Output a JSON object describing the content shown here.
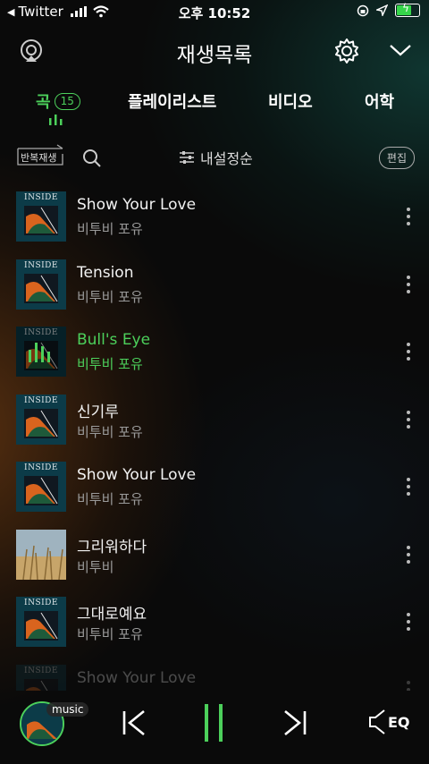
{
  "status_bar": {
    "back_app": "Twitter",
    "time": "오후 10:52"
  },
  "header": {
    "title": "재생목록"
  },
  "tabs": [
    {
      "label": "곡",
      "badge": "15",
      "active": true
    },
    {
      "label": "플레이리스트"
    },
    {
      "label": "비디오"
    },
    {
      "label": "어학"
    }
  ],
  "toolbar": {
    "repeat_label": "반복재생",
    "sort_label": "내설정순",
    "edit_label": "편집"
  },
  "songs": [
    {
      "title": "Show Your Love",
      "artist": "비투비 포유",
      "cover": "inside"
    },
    {
      "title": "Tension",
      "artist": "비투비 포유",
      "cover": "inside"
    },
    {
      "title": "Bull's Eye",
      "artist": "비투비 포유",
      "cover": "inside",
      "playing": true
    },
    {
      "title": "신기루",
      "artist": "비투비 포유",
      "cover": "inside"
    },
    {
      "title": "Show Your Love",
      "artist": "비투비 포유",
      "cover": "inside"
    },
    {
      "title": "그리워하다",
      "artist": "비투비",
      "cover": "field"
    },
    {
      "title": "그대로예요",
      "artist": "비투비 포유",
      "cover": "inside"
    },
    {
      "title": "Show Your Love",
      "artist": "비투비 포유",
      "cover": "inside",
      "faded": true
    }
  ],
  "cover_text": "INSIDE",
  "player": {
    "source_label": "music",
    "eq_label": "EQ"
  },
  "colors": {
    "accent": "#4cd05b",
    "cover_teal": "#0c3b48",
    "cover_orange": "#d9641e",
    "cover_green": "#1e5a3a"
  },
  "icons": {
    "header_left": "airplay-icon",
    "header_settings": "gear-icon",
    "header_collapse": "chevron-down-icon",
    "search": "search-icon",
    "sort": "sliders-icon",
    "more": "more-vertical-icon",
    "prev": "previous-icon",
    "pause": "pause-icon",
    "next": "next-icon",
    "eq": "speaker-eq-icon"
  }
}
